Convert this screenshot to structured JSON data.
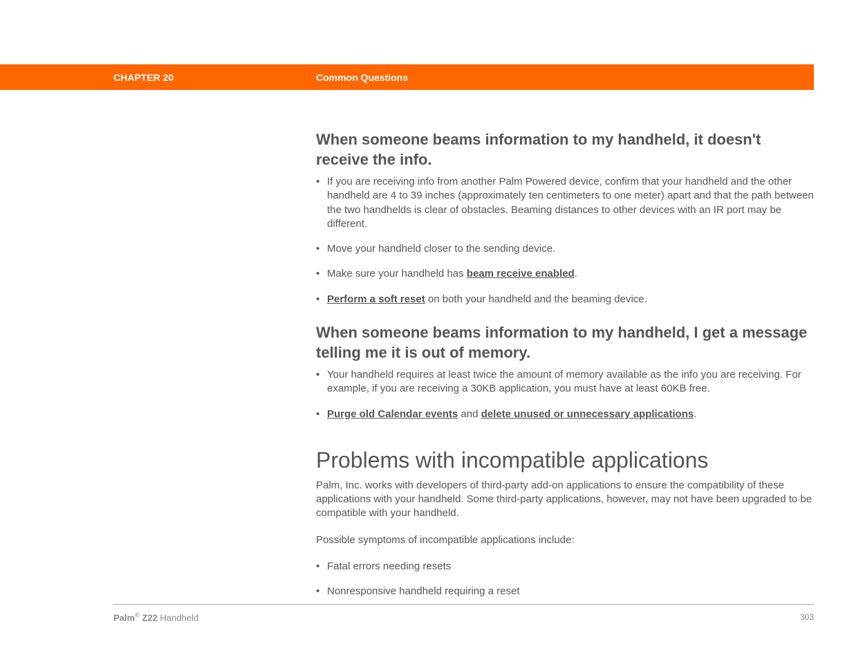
{
  "header": {
    "chapter": "CHAPTER 20",
    "title": "Common Questions"
  },
  "q1": {
    "heading": "When someone beams information to my handheld, it doesn't receive the info.",
    "bullet1": "If you are receiving info from another Palm Powered device, confirm that your handheld and the other handheld are 4 to 39 inches (approximately ten centimeters to one meter) apart and that the path between the two handhelds is clear of obstacles. Beaming distances to other devices with an IR port may be different.",
    "bullet2": "Move your handheld closer to the sending device.",
    "bullet3_a": "Make sure your handheld has ",
    "bullet3_link": "beam receive enabled",
    "bullet3_b": ".",
    "bullet4_link": "Perform a soft reset",
    "bullet4_b": " on both your handheld and the beaming device."
  },
  "q2": {
    "heading": "When someone beams information to my handheld, I get a message telling me it is out of memory.",
    "bullet1": "Your handheld requires at least twice the amount of memory available as the info you are receiving. For example, if you are receiving a 30KB application, you must have at least 60KB free.",
    "bullet2_link1": "Purge old Calendar events",
    "bullet2_mid": " and ",
    "bullet2_link2": "delete unused or unnecessary applications",
    "bullet2_end": "."
  },
  "section": {
    "heading": "Problems with incompatible applications",
    "p1": "Palm, Inc. works with developers of third-party add-on applications to ensure the compatibility of these applications with your handheld. Some third-party applications, however, may not have been upgraded to be compatible with your handheld.",
    "p2": "Possible symptoms of incompatible applications include:",
    "bullet1": "Fatal errors needing resets",
    "bullet2": "Nonresponsive handheld requiring a reset"
  },
  "footer": {
    "brand_bold": "Palm",
    "brand_reg": "®",
    "brand_model": " Z22",
    "brand_word": " Handheld",
    "page": "303"
  }
}
